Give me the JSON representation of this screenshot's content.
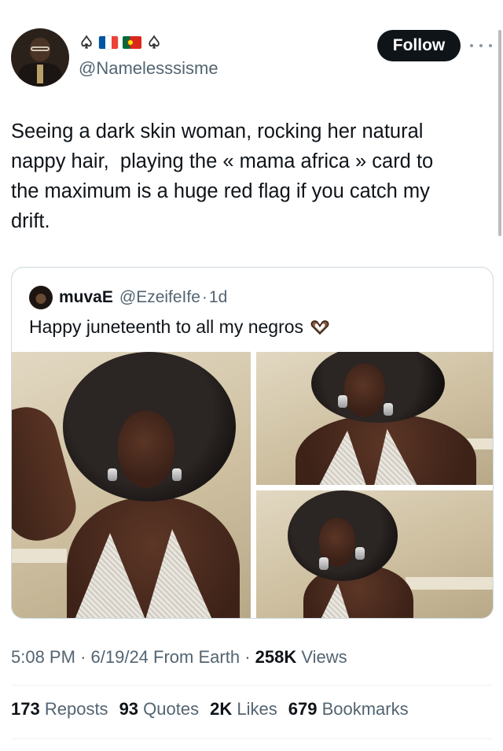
{
  "author": {
    "handle": "@Namelesssisme",
    "bio_emojis": [
      "spade-suit-icon",
      "flag-france-icon",
      "flag-portugal-icon",
      "spade-suit-icon"
    ],
    "follow_label": "Follow"
  },
  "tweet": {
    "text": "Seeing a dark skin woman, rocking her natural\nnappy hair,  playing the « mama africa » card to\nthe maximum is a huge red flag if you catch my\ndrift."
  },
  "quote": {
    "name": "muvaE",
    "handle": "@EzeifeIfe",
    "sep": "·",
    "time": "1d",
    "text": "Happy juneteenth to all my negros",
    "emoji": "heart-hands-icon",
    "photos": [
      "photo-1",
      "photo-2",
      "photo-3"
    ]
  },
  "meta": {
    "time": "5:08 PM",
    "sep1": "·",
    "date": "6/19/24",
    "source": "From Earth",
    "sep2": "·",
    "views_count": "258K",
    "views_label": "Views"
  },
  "stats": [
    {
      "count": "173",
      "label": "Reposts"
    },
    {
      "count": "93",
      "label": "Quotes"
    },
    {
      "count": "2K",
      "label": "Likes"
    },
    {
      "count": "679",
      "label": "Bookmarks"
    }
  ],
  "colors": {
    "text_primary": "#0f1419",
    "text_secondary": "#536471",
    "follow_bg": "#0f1419",
    "border": "#cfd9de"
  }
}
